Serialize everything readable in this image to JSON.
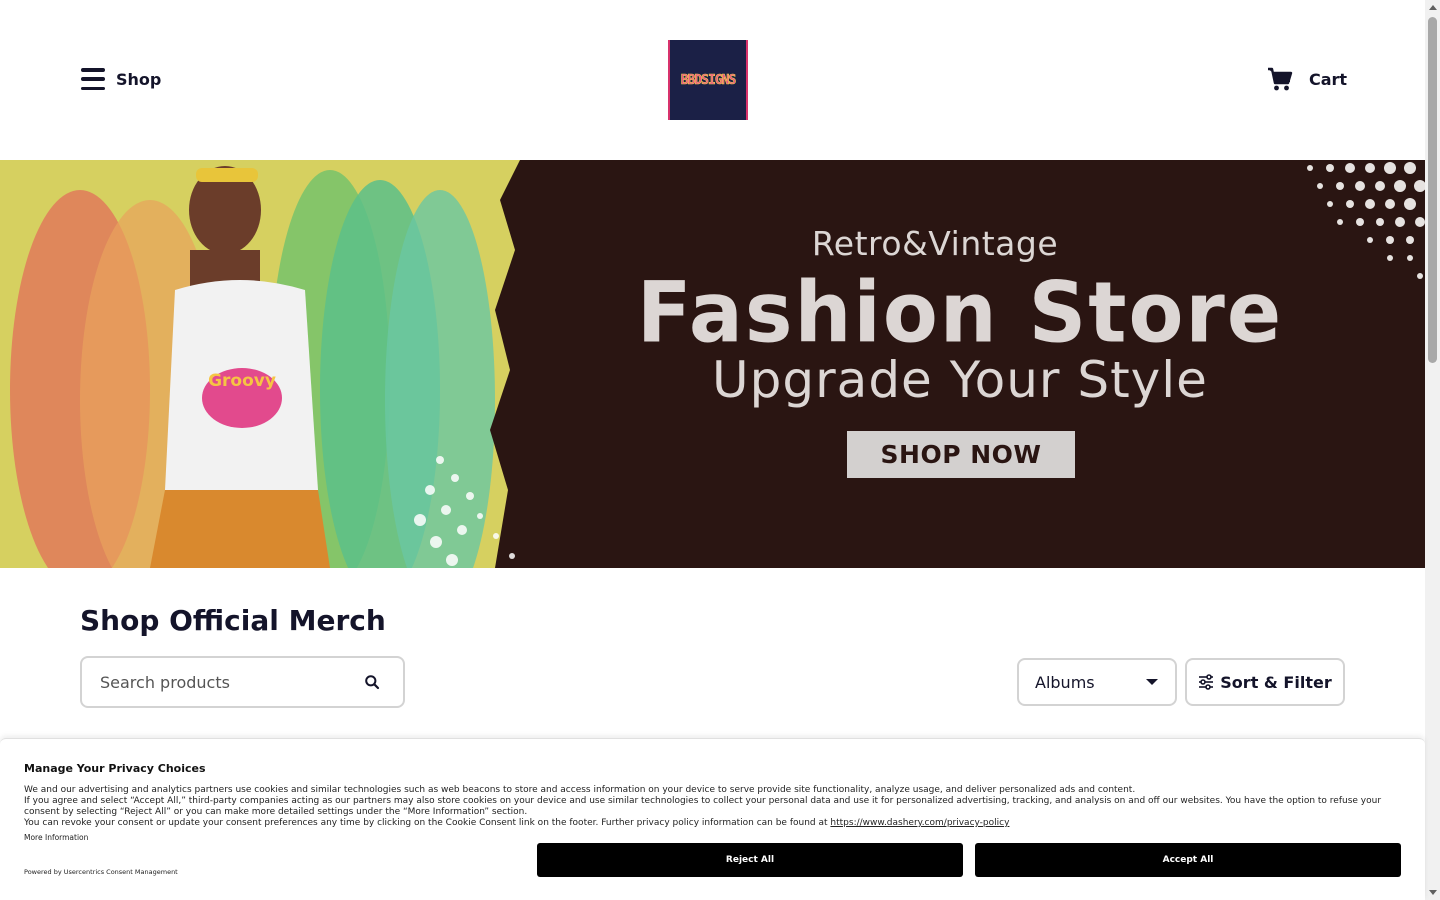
{
  "header": {
    "menu_label": "Shop",
    "logo_text": "BBDSIGNS",
    "cart_label": "Cart"
  },
  "banner": {
    "subtitle": "Retro&Vintage",
    "title": "Fashion Store",
    "tagline": "Upgrade Your Style",
    "cta_label": "SHOP NOW",
    "shirt_text": "Groovy"
  },
  "main": {
    "section_title": "Shop Official Merch",
    "search_placeholder": "Search products",
    "category_selected": "Albums",
    "sort_filter_label": "Sort & Filter"
  },
  "consent": {
    "title": "Manage Your Privacy Choices",
    "line1": "We and our advertising and analytics partners use cookies and similar technologies such as web beacons to store and access information on your device to serve provide site functionality, analyze usage, and deliver personalized ads and content.",
    "line2": "If you agree and select “Accept All,” third-party companies acting as our partners may also store cookies on your device and use similar technologies to collect your personal data and use it for personalized advertising, tracking, and analysis on and off our websites. You have the option to refuse your consent by selecting “Reject All” or you can make more detailed settings under the “More Information” section.",
    "line3": "You can revoke your consent or update your consent preferences any time by clicking on the Cookie Consent link on the footer. Further privacy policy information can be found at",
    "policy_link": "https://www.dashery.com/privacy-policy",
    "more_info_label": "More Information",
    "powered_by": "Powered by Usercentrics Consent Management",
    "reject_label": "Reject All",
    "accept_label": "Accept All"
  },
  "icons": {
    "menu": "hamburger-icon",
    "cart": "cart-icon",
    "search": "search-icon",
    "dropdown": "chevron-down-icon",
    "filter": "sliders-icon"
  },
  "colors": {
    "banner_dark": "#2a1512",
    "banner_yellow": "#d6d060",
    "banner_text": "#dcd6d4",
    "text_primary": "#14142a",
    "button_black": "#000000"
  }
}
